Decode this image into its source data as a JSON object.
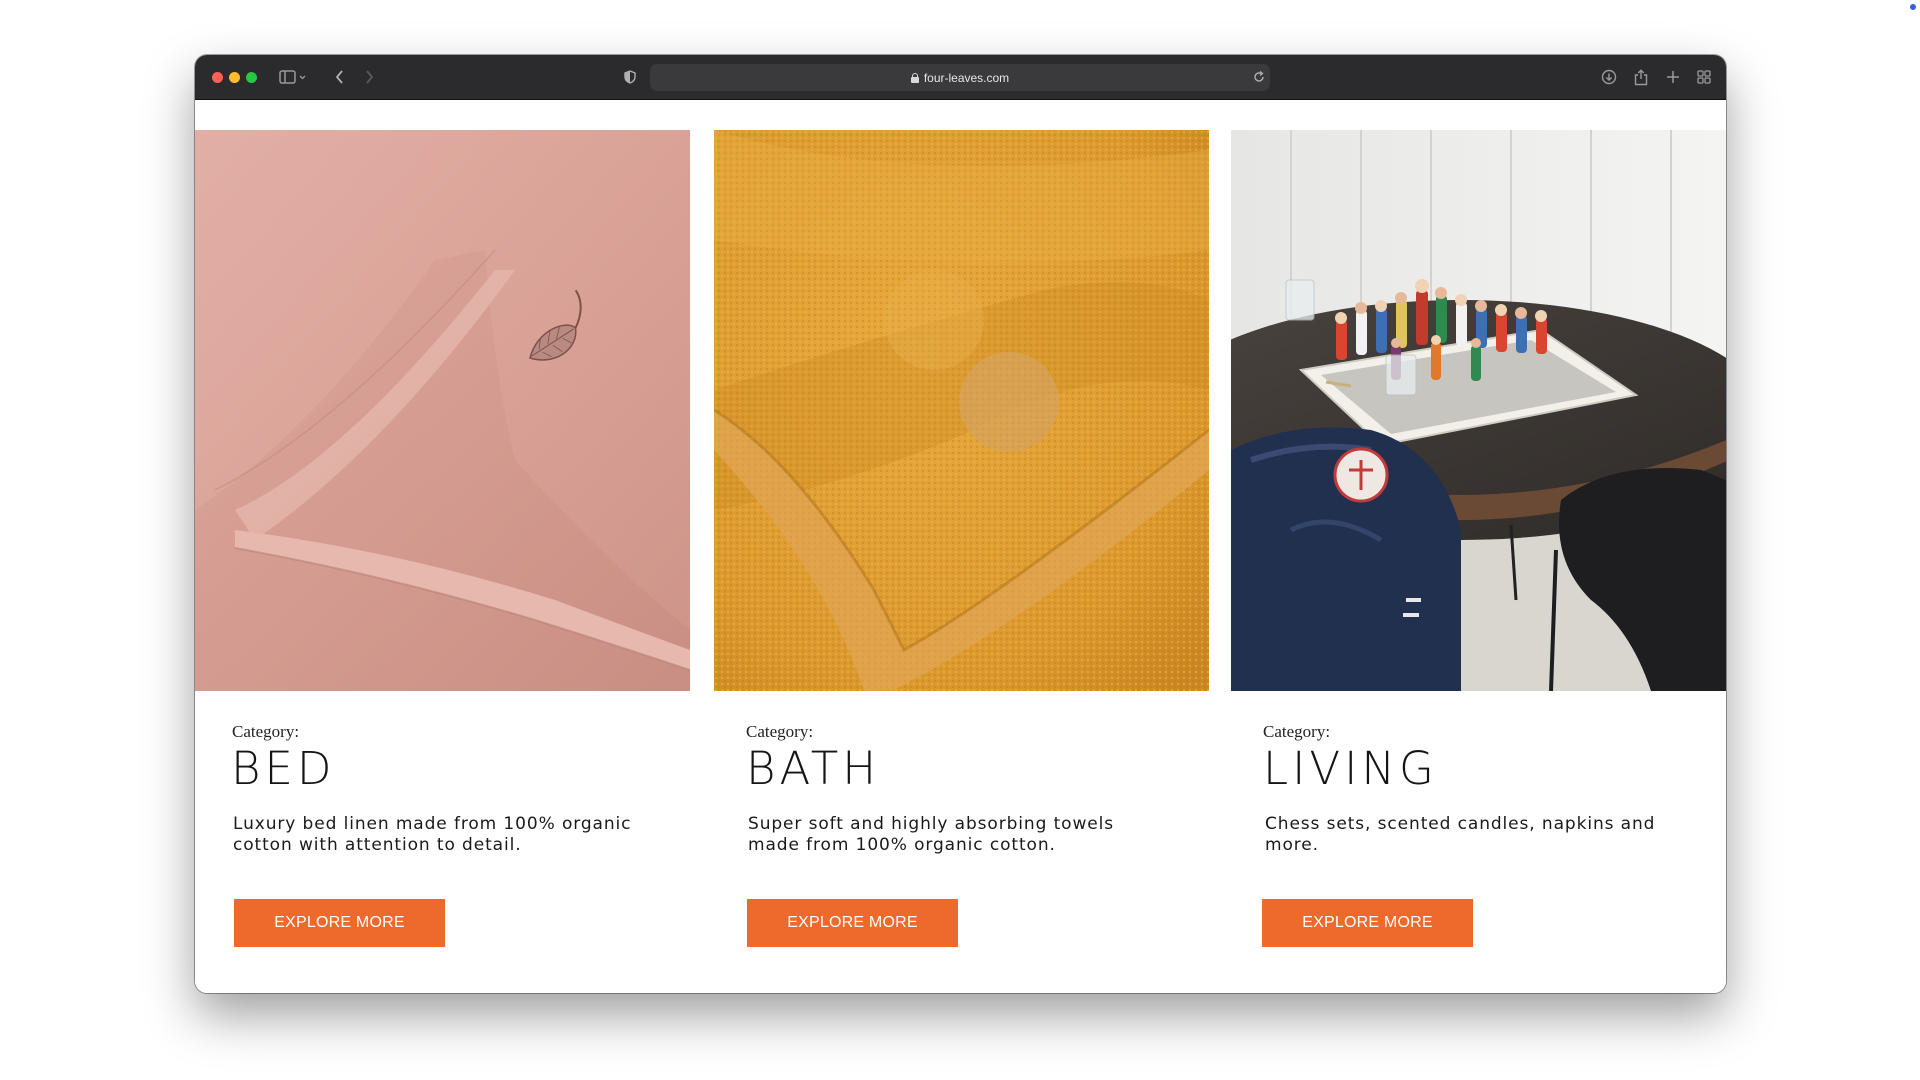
{
  "browser": {
    "url": "four-leaves.com"
  },
  "categories": [
    {
      "label": "Category:",
      "title": "BED",
      "description": "Luxury bed linen made from 100% organic cotton with attention to detail.",
      "button": "EXPLORE MORE"
    },
    {
      "label": "Category:",
      "title": "BATH",
      "description": "Super soft and highly absorbing towels made from 100% organic cotton.",
      "button": "EXPLORE MORE"
    },
    {
      "label": "Category:",
      "title": "LIVING",
      "description": "Chess sets, scented candles, napkins and more.",
      "button": "EXPLORE MORE"
    }
  ],
  "colors": {
    "accent": "#ee6a2c",
    "titlebar": "#2b2b2d"
  },
  "icons": [
    "sidebar-icon",
    "chevron-left-icon",
    "chevron-right-icon",
    "shield-icon",
    "lock-icon",
    "reload-icon",
    "download-icon",
    "share-icon",
    "plus-icon",
    "tabs-grid-icon"
  ]
}
